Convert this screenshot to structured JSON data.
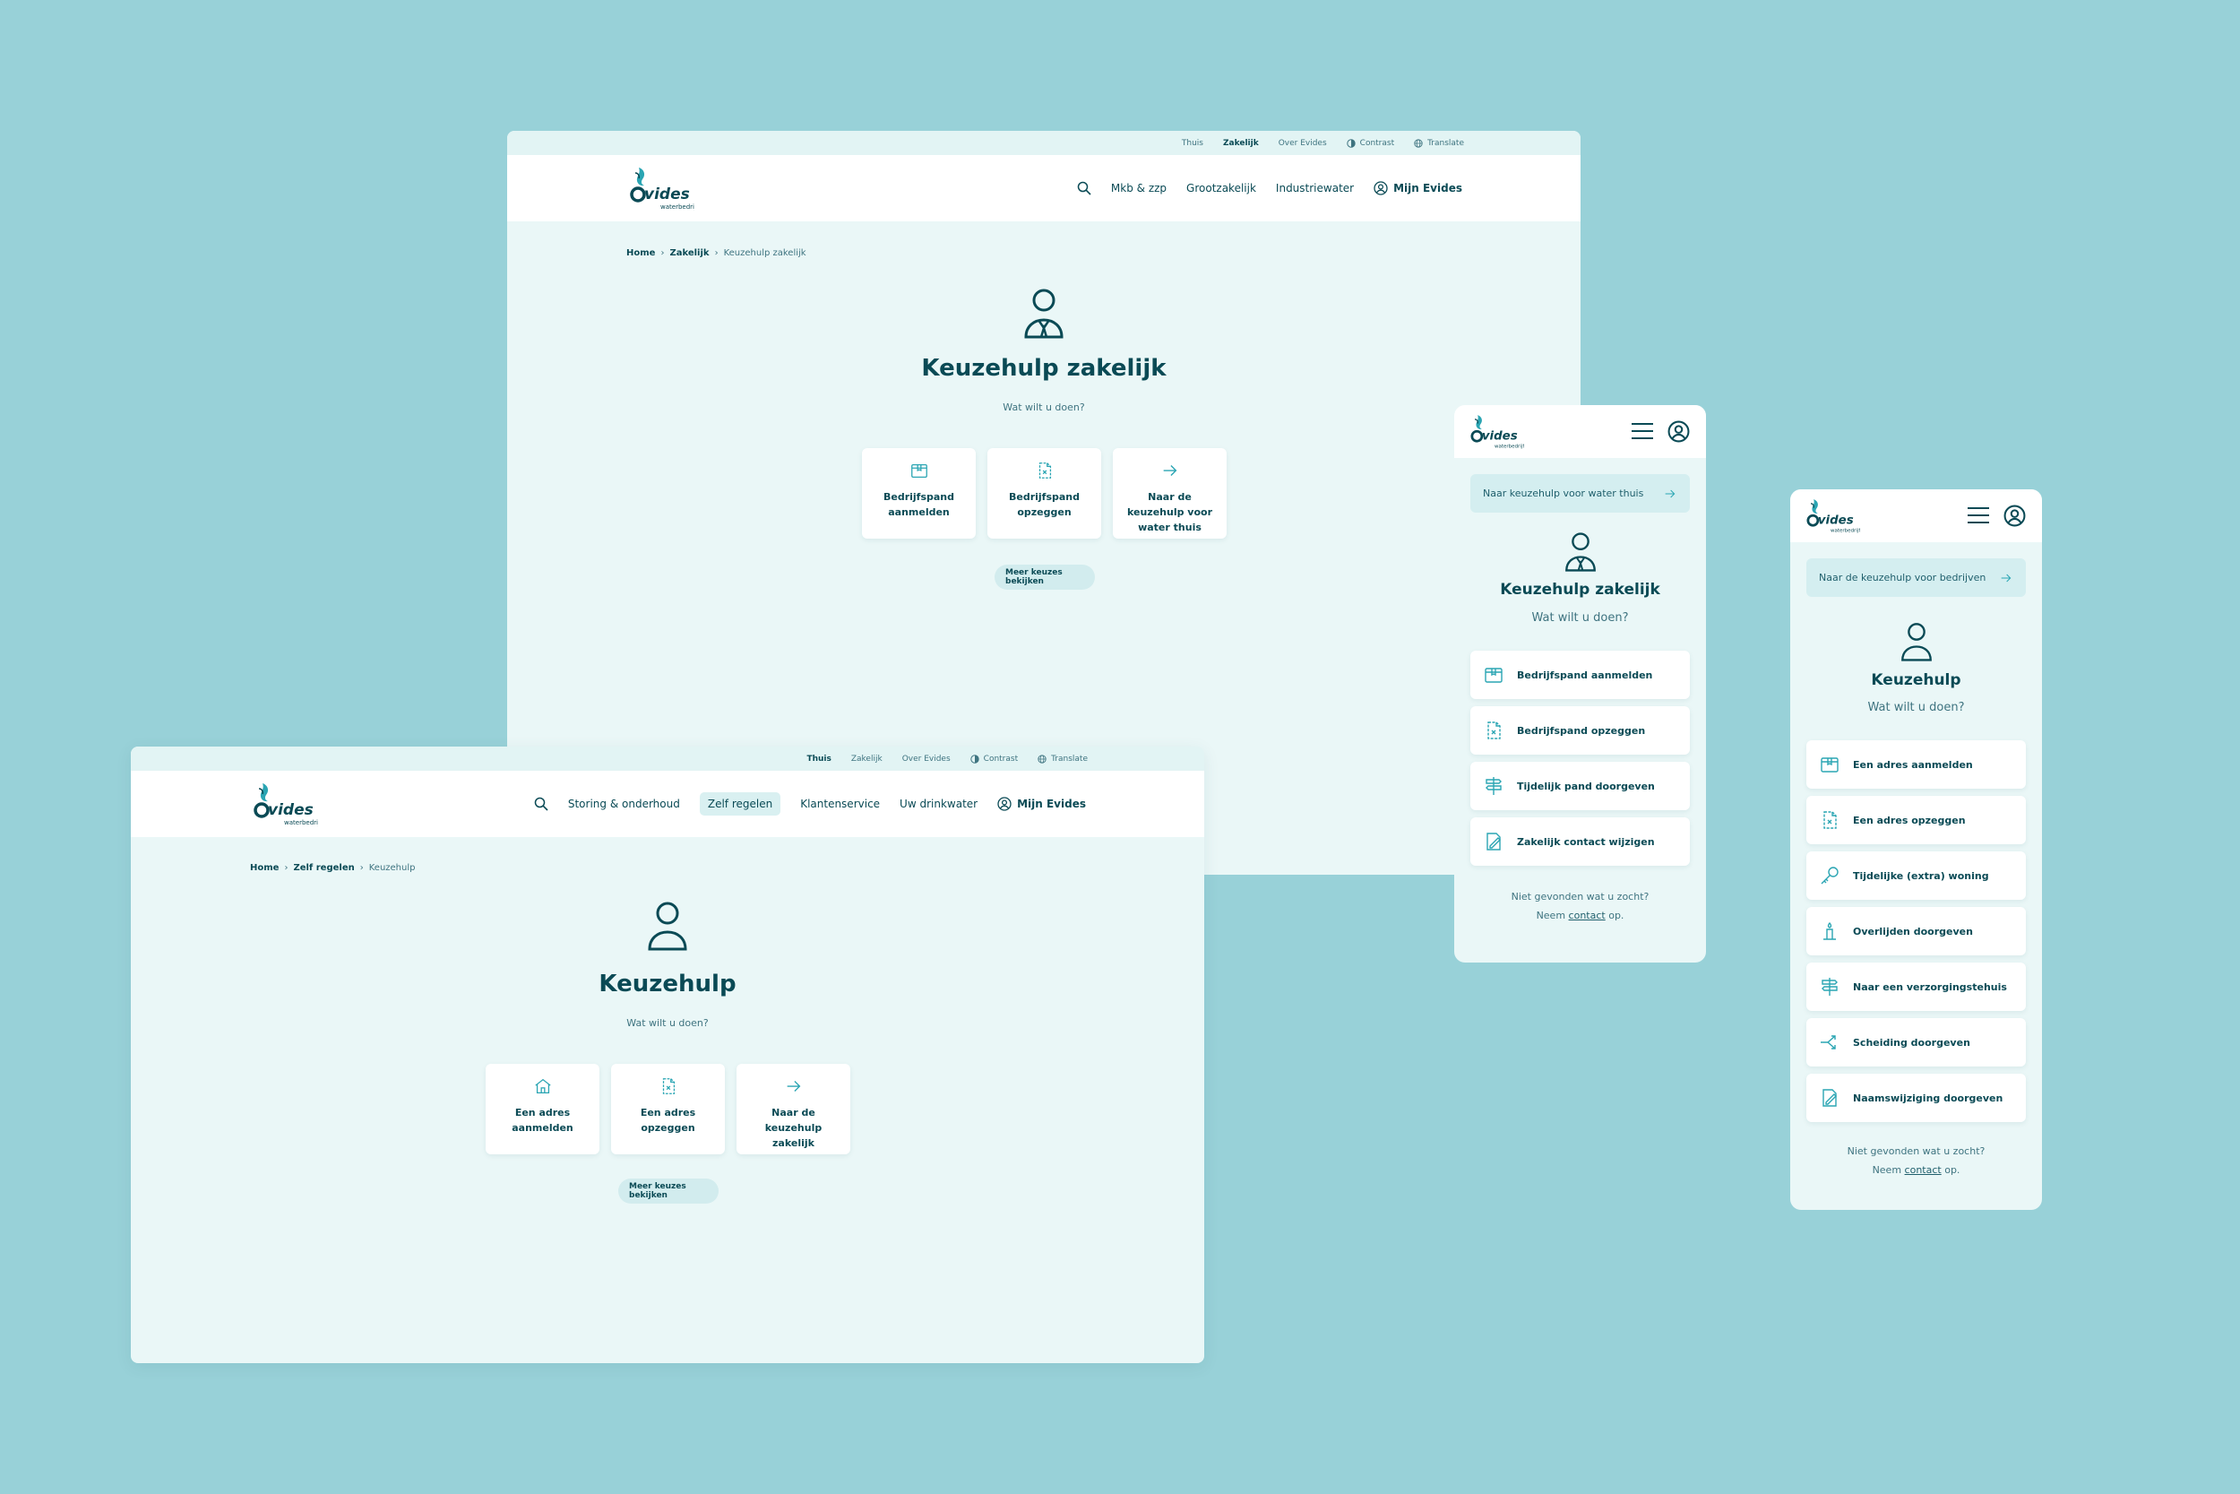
{
  "colors": {
    "background": "#98d1d8",
    "page": "#eaf7f7",
    "primary": "#0a4a55",
    "accent": "#2aa5b3"
  },
  "logo": {
    "name": "Evides",
    "tagline": "waterbedrijf"
  },
  "desktop_business": {
    "topbar": {
      "items": [
        "Thuis",
        "Zakelijk",
        "Over Evides"
      ],
      "contrast": "Contrast",
      "translate": "Translate"
    },
    "nav": {
      "items": [
        "Mkb & zzp",
        "Grootzakelijk",
        "Industriewater"
      ],
      "account": "Mijn Evides"
    },
    "breadcrumb": {
      "home": "Home",
      "section": "Zakelijk",
      "current": "Keuzehulp zakelijk"
    },
    "title": "Keuzehulp zakelijk",
    "subtitle": "Wat wilt u doen?",
    "tiles": [
      {
        "label": "Bedrijfspand aanmelden",
        "icon": "box-icon"
      },
      {
        "label": "Bedrijfspand opzeggen",
        "icon": "document-cancel-icon"
      },
      {
        "label": "Naar de keuzehulp voor water thuis",
        "icon": "arrow-right-icon"
      }
    ],
    "more_button": "Meer keuzes bekijken"
  },
  "desktop_home": {
    "topbar": {
      "items": [
        "Thuis",
        "Zakelijk",
        "Over Evides"
      ],
      "contrast": "Contrast",
      "translate": "Translate"
    },
    "nav": {
      "items": [
        "Storing & onderhoud",
        "Zelf regelen",
        "Klantenservice",
        "Uw drinkwater"
      ],
      "active": "Zelf regelen",
      "account": "Mijn Evides"
    },
    "breadcrumb": {
      "home": "Home",
      "section": "Zelf regelen",
      "current": "Keuzehulp"
    },
    "title": "Keuzehulp",
    "subtitle": "Wat wilt u doen?",
    "tiles": [
      {
        "label": "Een adres aanmelden",
        "icon": "house-icon"
      },
      {
        "label": "Een adres opzeggen",
        "icon": "document-cancel-icon"
      },
      {
        "label": "Naar de keuzehulp zakelijk",
        "icon": "arrow-right-icon"
      }
    ],
    "more_button": "Meer keuzes bekijken"
  },
  "mobile_business": {
    "switch_link": "Naar keuzehulp voor water thuis",
    "title": "Keuzehulp zakelijk",
    "subtitle": "Wat wilt u doen?",
    "items": [
      "Bedrijfspand aanmelden",
      "Bedrijfspand opzeggen",
      "Tijdelijk pand doorgeven",
      "Zakelijk contact wijzigen"
    ],
    "footer_line1": "Niet gevonden wat u zocht?",
    "footer_pre": "Neem",
    "footer_link": "contact",
    "footer_post": "op."
  },
  "mobile_home": {
    "switch_link": "Naar de keuzehulp voor bedrijven",
    "title": "Keuzehulp",
    "subtitle": "Wat wilt u doen?",
    "items": [
      "Een adres aanmelden",
      "Een adres opzeggen",
      "Tijdelijke (extra) woning",
      "Overlijden doorgeven",
      "Naar een verzorgingstehuis",
      "Scheiding doorgeven",
      "Naamswijziging doorgeven"
    ],
    "footer_line1": "Niet gevonden wat u zocht?",
    "footer_pre": "Neem",
    "footer_link": "contact",
    "footer_post": "op."
  }
}
